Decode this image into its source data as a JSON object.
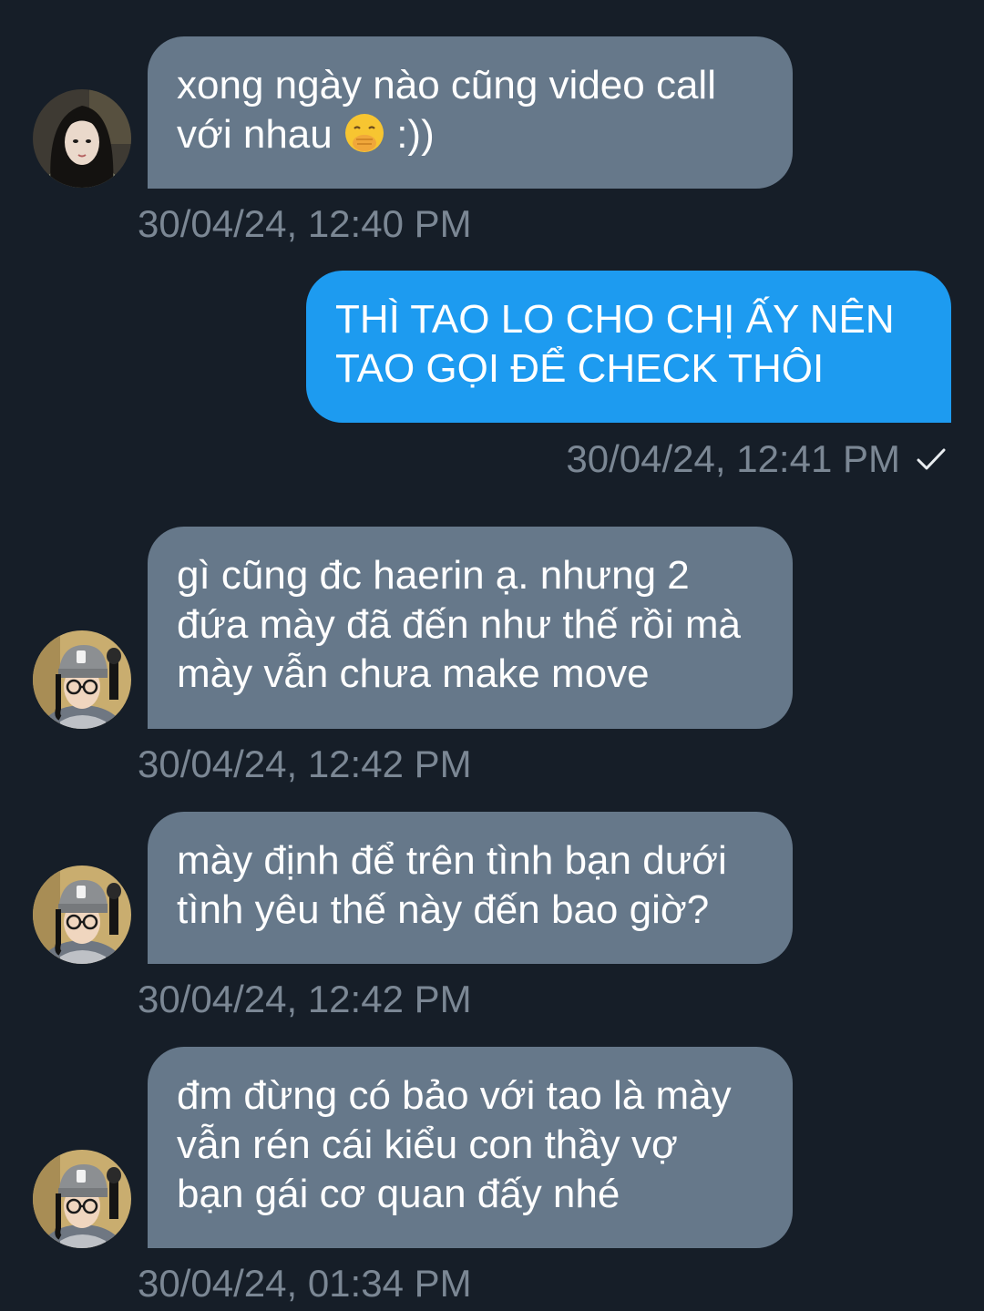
{
  "colors": {
    "background": "#161e28",
    "incoming_bubble": "#66788a",
    "outgoing_bubble": "#1d9bf0",
    "timestamp": "#7b8794"
  },
  "messages": [
    {
      "direction": "incoming",
      "text_before_emoji": "xong ngày nào cũng video call\nvới nhau ",
      "emoji": "face-with-hand-over-mouth-emoji",
      "text_after_emoji": " :))",
      "timestamp": "30/04/24, 12:40 PM"
    },
    {
      "direction": "outgoing",
      "text": "THÌ TAO LO CHO CHỊ ẤY NÊN\nTAO GỌI ĐỂ CHECK THÔI",
      "timestamp": "30/04/24, 12:41 PM",
      "status_icon": "check-icon"
    },
    {
      "direction": "incoming",
      "text": "gì cũng đc haerin ạ. nhưng 2\nđứa mày đã đến như thế rồi mà\nmày vẫn chưa make move",
      "timestamp": "30/04/24, 12:42 PM"
    },
    {
      "direction": "incoming",
      "text": "mày định để trên tình bạn dưới\ntình yêu thế này đến bao giờ?",
      "timestamp": "30/04/24, 12:42 PM"
    },
    {
      "direction": "incoming",
      "text": "đm đừng có bảo với tao là mày\nvẫn rén cái kiểu con thầy vợ\nbạn gái cơ quan đấy nhé",
      "timestamp": "30/04/24, 01:34 PM"
    }
  ]
}
